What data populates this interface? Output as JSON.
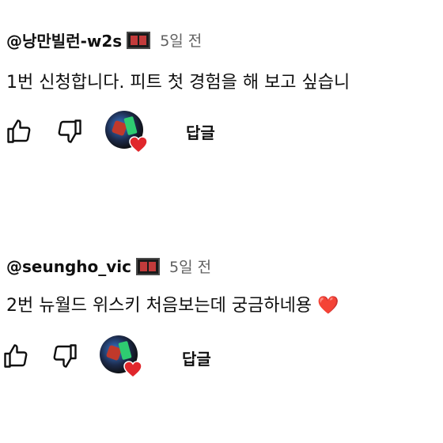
{
  "comments": [
    {
      "author": "@낭만빌런-w2s",
      "time": "5일 전",
      "text": "1번 신청합니다. 피트 첫 경험을 해  보고 싶습니",
      "reply_label": "답글"
    },
    {
      "author": "@seungho_vic",
      "time": "5일 전",
      "text": "2번 뉴월드 위스키 처음보는데 궁금하네용",
      "emoji": "❤️",
      "reply_label": "답글"
    }
  ],
  "icons": {
    "like": "thumbs-up-icon",
    "dislike": "thumbs-down-icon",
    "creator_heart": "creator-heart-icon"
  },
  "colors": {
    "heart": "#e0272c",
    "text": "#0f0f0f",
    "meta": "#606060"
  }
}
